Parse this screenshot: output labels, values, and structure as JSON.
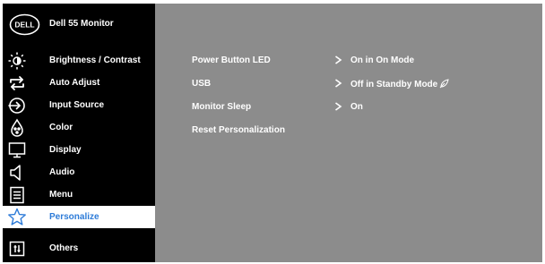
{
  "header": {
    "logo_text": "DELL",
    "title": "Dell 55 Monitor"
  },
  "sidebar": {
    "items": [
      {
        "label": "Brightness / Contrast",
        "icon": "brightness-icon"
      },
      {
        "label": "Auto Adjust",
        "icon": "auto-adjust-icon"
      },
      {
        "label": "Input Source",
        "icon": "input-source-icon"
      },
      {
        "label": "Color",
        "icon": "color-icon"
      },
      {
        "label": "Display",
        "icon": "display-icon"
      },
      {
        "label": "Audio",
        "icon": "audio-icon"
      },
      {
        "label": "Menu",
        "icon": "menu-icon"
      },
      {
        "label": "Personalize",
        "icon": "star-icon",
        "selected": true
      },
      {
        "label": "Others",
        "icon": "others-icon"
      }
    ]
  },
  "settings": {
    "rows": [
      {
        "name": "Power Button LED",
        "value": "On in On Mode"
      },
      {
        "name": "USB",
        "value": "Off in Standby Mode"
      },
      {
        "name": "Monitor Sleep",
        "value": "On"
      },
      {
        "name": "Reset Personalization",
        "value": ""
      }
    ]
  },
  "colors": {
    "sidebar_bg": "#000000",
    "content_bg": "#8c8c8c",
    "selected_bg": "#ffffff",
    "accent": "#2d7bd8",
    "text": "#ffffff"
  }
}
